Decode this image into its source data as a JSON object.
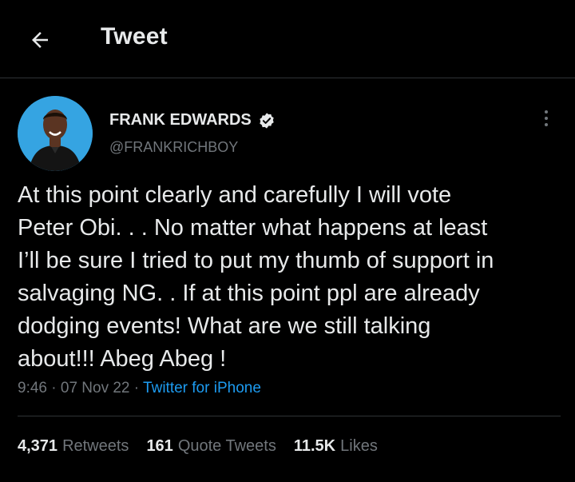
{
  "header": {
    "title": "Tweet",
    "back_icon": "arrow-left-icon"
  },
  "tweet": {
    "author": {
      "name": "FRANK EDWARDS",
      "handle": "@FRANKRICHBOY",
      "verified_icon": "verified-badge-icon"
    },
    "more_icon": "more-vertical-icon",
    "text": "At this point clearly and carefully I will vote\nPeter Obi. . . No matter what happens at least\nI’ll be sure I tried to put my thumb of support in\nsalvaging NG. . If at this point ppl are already\ndodging events! What are we still talking\nabout!!! Abeg Abeg !",
    "time": "9:46",
    "separator": "·",
    "date": "07 Nov 22",
    "source": "Twitter for iPhone"
  },
  "stats": {
    "retweets_count": "4,371",
    "retweets_label": "Retweets",
    "quotes_count": "161",
    "quotes_label": "Quote Tweets",
    "likes_count": "11.5K",
    "likes_label": "Likes"
  },
  "colors": {
    "background": "#000000",
    "text_primary": "#e7e9ea",
    "text_secondary": "#71767b",
    "accent": "#1d9bf0",
    "border": "#2f3336",
    "avatar_bg": "#33a3e0"
  }
}
